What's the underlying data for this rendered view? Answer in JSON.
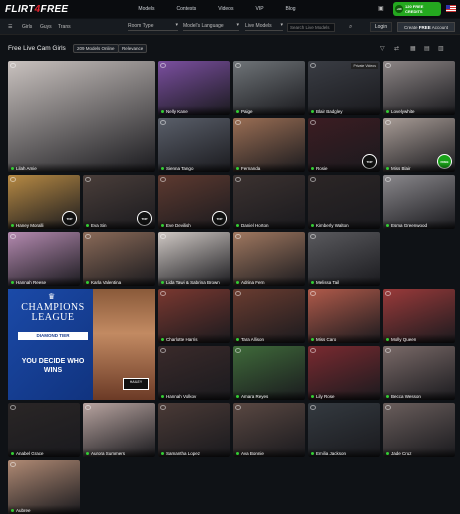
{
  "header": {
    "logo_a": "FLIRT",
    "logo_b": "4",
    "logo_c": "FREE",
    "nav": [
      "Models",
      "Contests",
      "Videos",
      "VIP",
      "Blog"
    ],
    "credit_top": "120 FREE",
    "credit_bottom": "CREDITS",
    "credit_badge": "+90"
  },
  "filterbar": {
    "girls": "Girls",
    "guys": "Guys",
    "trans": "Trans",
    "room_type": "Room Type",
    "language": "Model's Language",
    "live_models": "Live Models",
    "search_placeholder": "Search Live Models",
    "login": "Login",
    "create_a": "Create ",
    "create_b": "FREE",
    "create_c": " Account"
  },
  "section": {
    "title": "Free Live Cam Girls",
    "online": "209 Models Online",
    "relevance": "Relevance"
  },
  "ad": {
    "title": "CHAMPIONS LEAGUE",
    "tier": "DIAMOND TIER",
    "slogan": "YOU DECIDE WHO WINS",
    "tag": "HAILEY"
  },
  "private_label": "Private Videos",
  "models": [
    {
      "name": "Lilah Amie",
      "color": "#c9c2bf",
      "big": true
    },
    {
      "name": "Nelly Kane",
      "color": "#7b4fa0"
    },
    {
      "name": "Paige",
      "color": "#6f7478"
    },
    {
      "name": "Blair Badgley",
      "color": "#3a3d44",
      "private": true
    },
    {
      "name": "Lovelywhite",
      "color": "#8c8585"
    },
    {
      "name": "Sienna Tango",
      "color": "#5a5f6a"
    },
    {
      "name": "Fernanda",
      "color": "#9a6e54"
    },
    {
      "name": "Rosie",
      "color": "#3c1c22",
      "badge": "TOP"
    },
    {
      "name": "Miss Blair",
      "color": "#a89c96",
      "badge": "FREE"
    },
    {
      "name": "Haney Moralli",
      "color": "#b78a44",
      "badge": "TOP"
    },
    {
      "name": "Eva Sin",
      "color": "#4a3e3a",
      "badge": "TOP"
    },
    {
      "name": "Eve Devilish",
      "color": "#5e3a30",
      "badge": "TOP"
    },
    {
      "name": "Daniel Horton",
      "color": "#3c3230"
    },
    {
      "name": "Kimberly Walton",
      "color": "#2c2626"
    },
    {
      "name": "Esma Greenwood",
      "color": "#8a888c"
    },
    {
      "name": "Hannah Reese",
      "color": "#b48ab0"
    },
    {
      "name": "Karla Valentina",
      "color": "#8a6a58"
    },
    {
      "name": "Lida Tawi & Sabrina Brown",
      "color": "#cfc8c4"
    },
    {
      "name": "Adrina Fern",
      "color": "#a07860"
    },
    {
      "name": "Melissa Tail",
      "color": "#5a5a5e"
    },
    {
      "name": "Charlotte Harris",
      "color": "#7a3830"
    },
    {
      "name": "Tara Allison",
      "color": "#6a3c30"
    },
    {
      "name": "Miss Caro",
      "color": "#b05a4a"
    },
    {
      "name": "Molly Queen",
      "color": "#9a3a3a"
    },
    {
      "name": "Hannah Volkov",
      "color": "#3a2a2a"
    },
    {
      "name": "Amara Reyes",
      "color": "#3f6a3a"
    },
    {
      "name": "Lily Rose",
      "color": "#7a2a30"
    },
    {
      "name": "Becca Wesson",
      "color": "#7a6a68"
    },
    {
      "name": "Anabel Grace",
      "color": "#2a2626"
    },
    {
      "name": "Aurora Summers",
      "color": "#b8a4a0"
    },
    {
      "name": "Samantha Lopez",
      "color": "#4a3a36"
    },
    {
      "name": "Ava Bonnie",
      "color": "#5a4842"
    },
    {
      "name": "Emilia Jackson",
      "color": "#343a40"
    },
    {
      "name": "Jade Cruz",
      "color": "#6a5e5c"
    },
    {
      "name": "Aubree",
      "color": "#b08a74"
    }
  ],
  "colors": {
    "accent_red": "#e8242f",
    "credit_green": "#24a81f",
    "ad_blue": "#1b4aa8"
  }
}
